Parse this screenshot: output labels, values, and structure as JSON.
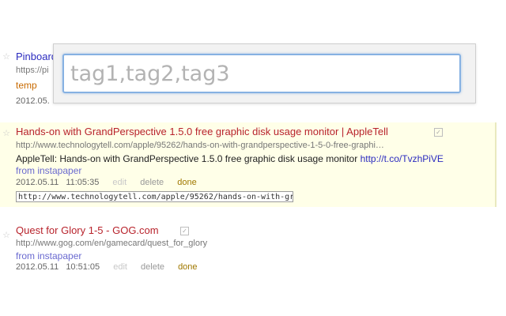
{
  "bookmarks": [
    {
      "title": "Pinboard",
      "url": "https://pi",
      "tag": "temp",
      "date": "2012.05.",
      "hidden_by_popup": true
    },
    {
      "title": "Hands-on with GrandPerspective 1.5.0 free graphic disk usage monitor | AppleTell",
      "url": "http://www.technologytell.com/apple/95262/hands-on-with-grandperspective-1-5-0-free-graphi…",
      "description_text": "AppleTell: Hands-on with GrandPerspective 1.5.0 free graphic disk usage monitor ",
      "description_link": "http://t.co/TvzhPiVE",
      "source": "from instapaper",
      "date": "2012.05.11",
      "time": "11:05:35",
      "actions": {
        "edit": "edit",
        "delete": "delete",
        "done": "done"
      },
      "url_box_value": "http://www.technologytell.com/apple/95262/hands-on-with-gr",
      "highlighted": true
    },
    {
      "title": "Quest for Glory 1-5 - GOG.com",
      "url": "http://www.gog.com/en/gamecard/quest_for_glory",
      "source": "from instapaper",
      "date": "2012.05.11",
      "time": "10:51:05",
      "actions": {
        "edit": "edit",
        "delete": "delete",
        "done": "done"
      }
    }
  ],
  "tag_popup": {
    "placeholder": "tag1,tag2,tag3",
    "value": ""
  },
  "colors": {
    "title_red": "#b8232c",
    "title_blue": "#2b2bbf",
    "highlight_bg": "#ffffe8",
    "focus_border": "#86b1e2",
    "done": "#a07800",
    "tag": "#c86a00"
  },
  "icons": {
    "star": "☆",
    "check": "✓"
  }
}
